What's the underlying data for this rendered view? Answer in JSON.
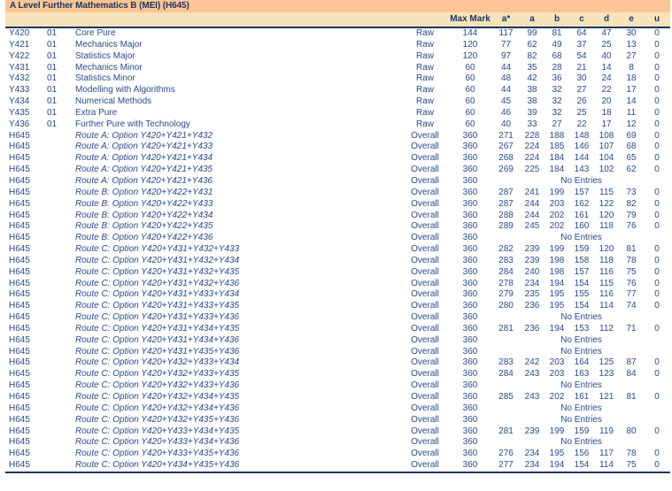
{
  "qualification": {
    "title": "A Level Further Mathematics B (MEI) (H645)"
  },
  "columns": {
    "code": "",
    "component": "",
    "title": "",
    "mark_type": "",
    "max_mark": "Max Mark",
    "grades": [
      "a*",
      "a",
      "b",
      "c",
      "d",
      "e",
      "u"
    ]
  },
  "labels": {
    "no_entries": "No Entries",
    "raw": "Raw",
    "overall": "Overall"
  },
  "colors": {
    "title_band": "#FDC595",
    "header_band": "#F6E3BB",
    "text": "#2B4A86",
    "rule": "#17355F"
  },
  "rows": [
    {
      "code": "Y420",
      "component": "01",
      "title": "Core Pure",
      "type": "Raw",
      "max": "144",
      "grades": [
        "117",
        "99",
        "81",
        "64",
        "47",
        "30",
        "0"
      ],
      "italic": false,
      "no_entries": false
    },
    {
      "code": "Y421",
      "component": "01",
      "title": "Mechanics Major",
      "type": "Raw",
      "max": "120",
      "grades": [
        "77",
        "62",
        "49",
        "37",
        "25",
        "13",
        "0"
      ],
      "italic": false,
      "no_entries": false
    },
    {
      "code": "Y422",
      "component": "01",
      "title": "Statistics Major",
      "type": "Raw",
      "max": "120",
      "grades": [
        "97",
        "82",
        "68",
        "54",
        "40",
        "27",
        "0"
      ],
      "italic": false,
      "no_entries": false
    },
    {
      "code": "Y431",
      "component": "01",
      "title": "Mechanics Minor",
      "type": "Raw",
      "max": "60",
      "grades": [
        "44",
        "35",
        "28",
        "21",
        "14",
        "8",
        "0"
      ],
      "italic": false,
      "no_entries": false
    },
    {
      "code": "Y432",
      "component": "01",
      "title": "Statistics Minor",
      "type": "Raw",
      "max": "60",
      "grades": [
        "48",
        "42",
        "36",
        "30",
        "24",
        "18",
        "0"
      ],
      "italic": false,
      "no_entries": false
    },
    {
      "code": "Y433",
      "component": "01",
      "title": "Modelling with Algorithms",
      "type": "Raw",
      "max": "60",
      "grades": [
        "44",
        "38",
        "32",
        "27",
        "22",
        "17",
        "0"
      ],
      "italic": false,
      "no_entries": false
    },
    {
      "code": "Y434",
      "component": "01",
      "title": "Numerical Methods",
      "type": "Raw",
      "max": "60",
      "grades": [
        "45",
        "38",
        "32",
        "26",
        "20",
        "14",
        "0"
      ],
      "italic": false,
      "no_entries": false
    },
    {
      "code": "Y435",
      "component": "01",
      "title": "Extra Pure",
      "type": "Raw",
      "max": "60",
      "grades": [
        "46",
        "39",
        "32",
        "25",
        "18",
        "11",
        "0"
      ],
      "italic": false,
      "no_entries": false
    },
    {
      "code": "Y436",
      "component": "01",
      "title": "Further Pure with Technology",
      "type": "Raw",
      "max": "60",
      "grades": [
        "40",
        "33",
        "27",
        "22",
        "17",
        "12",
        "0"
      ],
      "italic": false,
      "no_entries": false
    },
    {
      "code": "H645",
      "component": "",
      "title": "Route A: Option Y420+Y421+Y432",
      "type": "Overall",
      "max": "360",
      "grades": [
        "271",
        "228",
        "188",
        "148",
        "108",
        "69",
        "0"
      ],
      "italic": true,
      "no_entries": false
    },
    {
      "code": "H645",
      "component": "",
      "title": "Route A: Option Y420+Y421+Y433",
      "type": "Overall",
      "max": "360",
      "grades": [
        "267",
        "224",
        "185",
        "146",
        "107",
        "68",
        "0"
      ],
      "italic": true,
      "no_entries": false
    },
    {
      "code": "H645",
      "component": "",
      "title": "Route A: Option Y420+Y421+Y434",
      "type": "Overall",
      "max": "360",
      "grades": [
        "268",
        "224",
        "184",
        "144",
        "104",
        "65",
        "0"
      ],
      "italic": true,
      "no_entries": false
    },
    {
      "code": "H645",
      "component": "",
      "title": "Route A: Option Y420+Y421+Y435",
      "type": "Overall",
      "max": "360",
      "grades": [
        "269",
        "225",
        "184",
        "143",
        "102",
        "62",
        "0"
      ],
      "italic": true,
      "no_entries": false
    },
    {
      "code": "H645",
      "component": "",
      "title": "Route A: Option Y420+Y421+Y436",
      "type": "Overall",
      "max": "360",
      "grades": [],
      "italic": true,
      "no_entries": true
    },
    {
      "code": "H645",
      "component": "",
      "title": "Route B: Option Y420+Y422+Y431",
      "type": "Overall",
      "max": "360",
      "grades": [
        "287",
        "241",
        "199",
        "157",
        "115",
        "73",
        "0"
      ],
      "italic": true,
      "no_entries": false
    },
    {
      "code": "H645",
      "component": "",
      "title": "Route B: Option Y420+Y422+Y433",
      "type": "Overall",
      "max": "360",
      "grades": [
        "287",
        "244",
        "203",
        "162",
        "122",
        "82",
        "0"
      ],
      "italic": true,
      "no_entries": false
    },
    {
      "code": "H645",
      "component": "",
      "title": "Route B: Option Y420+Y422+Y434",
      "type": "Overall",
      "max": "360",
      "grades": [
        "288",
        "244",
        "202",
        "161",
        "120",
        "79",
        "0"
      ],
      "italic": true,
      "no_entries": false
    },
    {
      "code": "H645",
      "component": "",
      "title": "Route B: Option Y420+Y422+Y435",
      "type": "Overall",
      "max": "360",
      "grades": [
        "289",
        "245",
        "202",
        "160",
        "118",
        "76",
        "0"
      ],
      "italic": true,
      "no_entries": false
    },
    {
      "code": "H645",
      "component": "",
      "title": "Route B: Option Y420+Y422+Y436",
      "type": "Overall",
      "max": "360",
      "grades": [],
      "italic": true,
      "no_entries": true
    },
    {
      "code": "H645",
      "component": "",
      "title": "Route C: Option Y420+Y431+Y432+Y433",
      "type": "Overall",
      "max": "360",
      "grades": [
        "282",
        "239",
        "199",
        "159",
        "120",
        "81",
        "0"
      ],
      "italic": true,
      "no_entries": false
    },
    {
      "code": "H645",
      "component": "",
      "title": "Route C: Option Y420+Y431+Y432+Y434",
      "type": "Overall",
      "max": "360",
      "grades": [
        "283",
        "239",
        "198",
        "158",
        "118",
        "78",
        "0"
      ],
      "italic": true,
      "no_entries": false
    },
    {
      "code": "H645",
      "component": "",
      "title": "Route C: Option Y420+Y431+Y432+Y435",
      "type": "Overall",
      "max": "360",
      "grades": [
        "284",
        "240",
        "198",
        "157",
        "116",
        "75",
        "0"
      ],
      "italic": true,
      "no_entries": false
    },
    {
      "code": "H645",
      "component": "",
      "title": "Route C: Option Y420+Y431+Y432+Y436",
      "type": "Overall",
      "max": "360",
      "grades": [
        "278",
        "234",
        "194",
        "154",
        "115",
        "76",
        "0"
      ],
      "italic": true,
      "no_entries": false
    },
    {
      "code": "H645",
      "component": "",
      "title": "Route C: Option Y420+Y431+Y433+Y434",
      "type": "Overall",
      "max": "360",
      "grades": [
        "279",
        "235",
        "195",
        "155",
        "116",
        "77",
        "0"
      ],
      "italic": true,
      "no_entries": false
    },
    {
      "code": "H645",
      "component": "",
      "title": "Route C: Option Y420+Y431+Y433+Y435",
      "type": "Overall",
      "max": "360",
      "grades": [
        "280",
        "236",
        "195",
        "154",
        "114",
        "74",
        "0"
      ],
      "italic": true,
      "no_entries": false
    },
    {
      "code": "H645",
      "component": "",
      "title": "Route C: Option Y420+Y431+Y433+Y436",
      "type": "Overall",
      "max": "360",
      "grades": [],
      "italic": true,
      "no_entries": true
    },
    {
      "code": "H645",
      "component": "",
      "title": "Route C: Option Y420+Y431+Y434+Y435",
      "type": "Overall",
      "max": "360",
      "grades": [
        "281",
        "236",
        "194",
        "153",
        "112",
        "71",
        "0"
      ],
      "italic": true,
      "no_entries": false
    },
    {
      "code": "H645",
      "component": "",
      "title": "Route C: Option Y420+Y431+Y434+Y436",
      "type": "Overall",
      "max": "360",
      "grades": [],
      "italic": true,
      "no_entries": true
    },
    {
      "code": "H645",
      "component": "",
      "title": "Route C: Option Y420+Y431+Y435+Y436",
      "type": "Overall",
      "max": "360",
      "grades": [],
      "italic": true,
      "no_entries": true
    },
    {
      "code": "H645",
      "component": "",
      "title": "Route C: Option Y420+Y432+Y433+Y434",
      "type": "Overall",
      "max": "360",
      "grades": [
        "283",
        "242",
        "203",
        "164",
        "125",
        "87",
        "0"
      ],
      "italic": true,
      "no_entries": false
    },
    {
      "code": "H645",
      "component": "",
      "title": "Route C: Option Y420+Y432+Y433+Y435",
      "type": "Overall",
      "max": "360",
      "grades": [
        "284",
        "243",
        "203",
        "163",
        "123",
        "84",
        "0"
      ],
      "italic": true,
      "no_entries": false
    },
    {
      "code": "H645",
      "component": "",
      "title": "Route C: Option Y420+Y432+Y433+Y436",
      "type": "Overall",
      "max": "360",
      "grades": [],
      "italic": true,
      "no_entries": true
    },
    {
      "code": "H645",
      "component": "",
      "title": "Route C: Option Y420+Y432+Y434+Y435",
      "type": "Overall",
      "max": "360",
      "grades": [
        "285",
        "243",
        "202",
        "161",
        "121",
        "81",
        "0"
      ],
      "italic": true,
      "no_entries": false
    },
    {
      "code": "H645",
      "component": "",
      "title": "Route C: Option Y420+Y432+Y434+Y436",
      "type": "Overall",
      "max": "360",
      "grades": [],
      "italic": true,
      "no_entries": true
    },
    {
      "code": "H645",
      "component": "",
      "title": "Route C: Option Y420+Y432+Y435+Y436",
      "type": "Overall",
      "max": "360",
      "grades": [],
      "italic": true,
      "no_entries": true
    },
    {
      "code": "H645",
      "component": "",
      "title": "Route C: Option Y420+Y433+Y434+Y435",
      "type": "Overall",
      "max": "360",
      "grades": [
        "281",
        "239",
        "199",
        "159",
        "119",
        "80",
        "0"
      ],
      "italic": true,
      "no_entries": false
    },
    {
      "code": "H645",
      "component": "",
      "title": "Route C: Option Y420+Y433+Y434+Y436",
      "type": "Overall",
      "max": "360",
      "grades": [],
      "italic": true,
      "no_entries": true
    },
    {
      "code": "H645",
      "component": "",
      "title": "Route C: Option Y420+Y433+Y435+Y436",
      "type": "Overall",
      "max": "360",
      "grades": [
        "276",
        "234",
        "195",
        "156",
        "117",
        "78",
        "0"
      ],
      "italic": true,
      "no_entries": false
    },
    {
      "code": "H645",
      "component": "",
      "title": "Route C: Option Y420+Y434+Y435+Y436",
      "type": "Overall",
      "max": "360",
      "grades": [
        "277",
        "234",
        "194",
        "154",
        "114",
        "75",
        "0"
      ],
      "italic": true,
      "no_entries": false
    }
  ]
}
